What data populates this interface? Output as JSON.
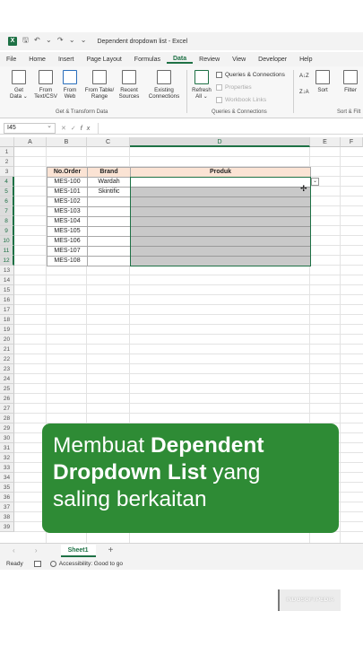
{
  "titlebar": {
    "app_icon": "X",
    "quick_access": "🖫 ↶ ⌄ ↷ ⌄ ⌄",
    "document_title": "Dependent dropdown list  -  Excel"
  },
  "menu_tabs": [
    "File",
    "Home",
    "Insert",
    "Page Layout",
    "Formulas",
    "Data",
    "Review",
    "View",
    "Developer",
    "Help"
  ],
  "active_tab": "Data",
  "ribbon": {
    "get_data": "Get\nData ⌄",
    "from_text": "From\nText/CSV",
    "from_web": "From\nWeb",
    "from_table": "From Table/\nRange",
    "recent_sources": "Recent\nSources",
    "existing_connections": "Existing\nConnections",
    "group_get_transform": "Get & Transform Data",
    "refresh_all": "Refresh\nAll ⌄",
    "queries_connections": "Queries & Connections",
    "properties": "Properties",
    "workbook_links": "Workbook Links",
    "group_queries": "Queries & Connections",
    "sort_az": "A↓Z",
    "sort_za": "Z↓A",
    "sort": "Sort",
    "filter": "Filter",
    "group_sort_filter": "Sort & Filt"
  },
  "formula_bar": {
    "name_box": "I45",
    "fx": "fx",
    "value": ""
  },
  "columns": [
    "A",
    "B",
    "C",
    "D",
    "E",
    "F"
  ],
  "selected_column": "D",
  "rows": [
    1,
    2,
    3,
    4,
    5,
    6,
    7,
    8,
    9,
    10,
    11,
    12,
    13,
    14,
    15,
    16,
    17,
    18,
    19,
    20,
    21,
    22,
    23,
    24,
    25,
    26,
    27,
    28,
    29,
    30,
    31,
    32,
    33,
    34,
    35,
    36,
    37,
    38,
    39
  ],
  "table": {
    "headers": [
      "No.Order",
      "Brand",
      "Produk"
    ],
    "rows": [
      [
        "MES-100",
        "Wardah",
        ""
      ],
      [
        "MES-101",
        "Skintific",
        ""
      ],
      [
        "MES-102",
        "",
        ""
      ],
      [
        "MES-103",
        "",
        ""
      ],
      [
        "MES-104",
        "",
        ""
      ],
      [
        "MES-105",
        "",
        ""
      ],
      [
        "MES-106",
        "",
        ""
      ],
      [
        "MES-107",
        "",
        ""
      ],
      [
        "MES-108",
        "",
        ""
      ]
    ]
  },
  "dropdown_arrow": "⌄",
  "banner": {
    "line1_a": "Membuat ",
    "line1_b": "Dependent",
    "line2_a": "Dropdown List",
    "line2_b": " yang",
    "line3": "saling berkaitan"
  },
  "sheets": {
    "nav": "‹ ›",
    "active": "Sheet1",
    "add": "+"
  },
  "status": {
    "ready": "Ready",
    "accessibility": "Accessibility: Good to go"
  },
  "watermark": "INDOSOFTPEDIA",
  "colors": {
    "excel_green": "#1e7145",
    "banner_green": "#2e8b35",
    "header_fill": "#fbe3d4",
    "gray_fill": "#c9c9c9"
  }
}
